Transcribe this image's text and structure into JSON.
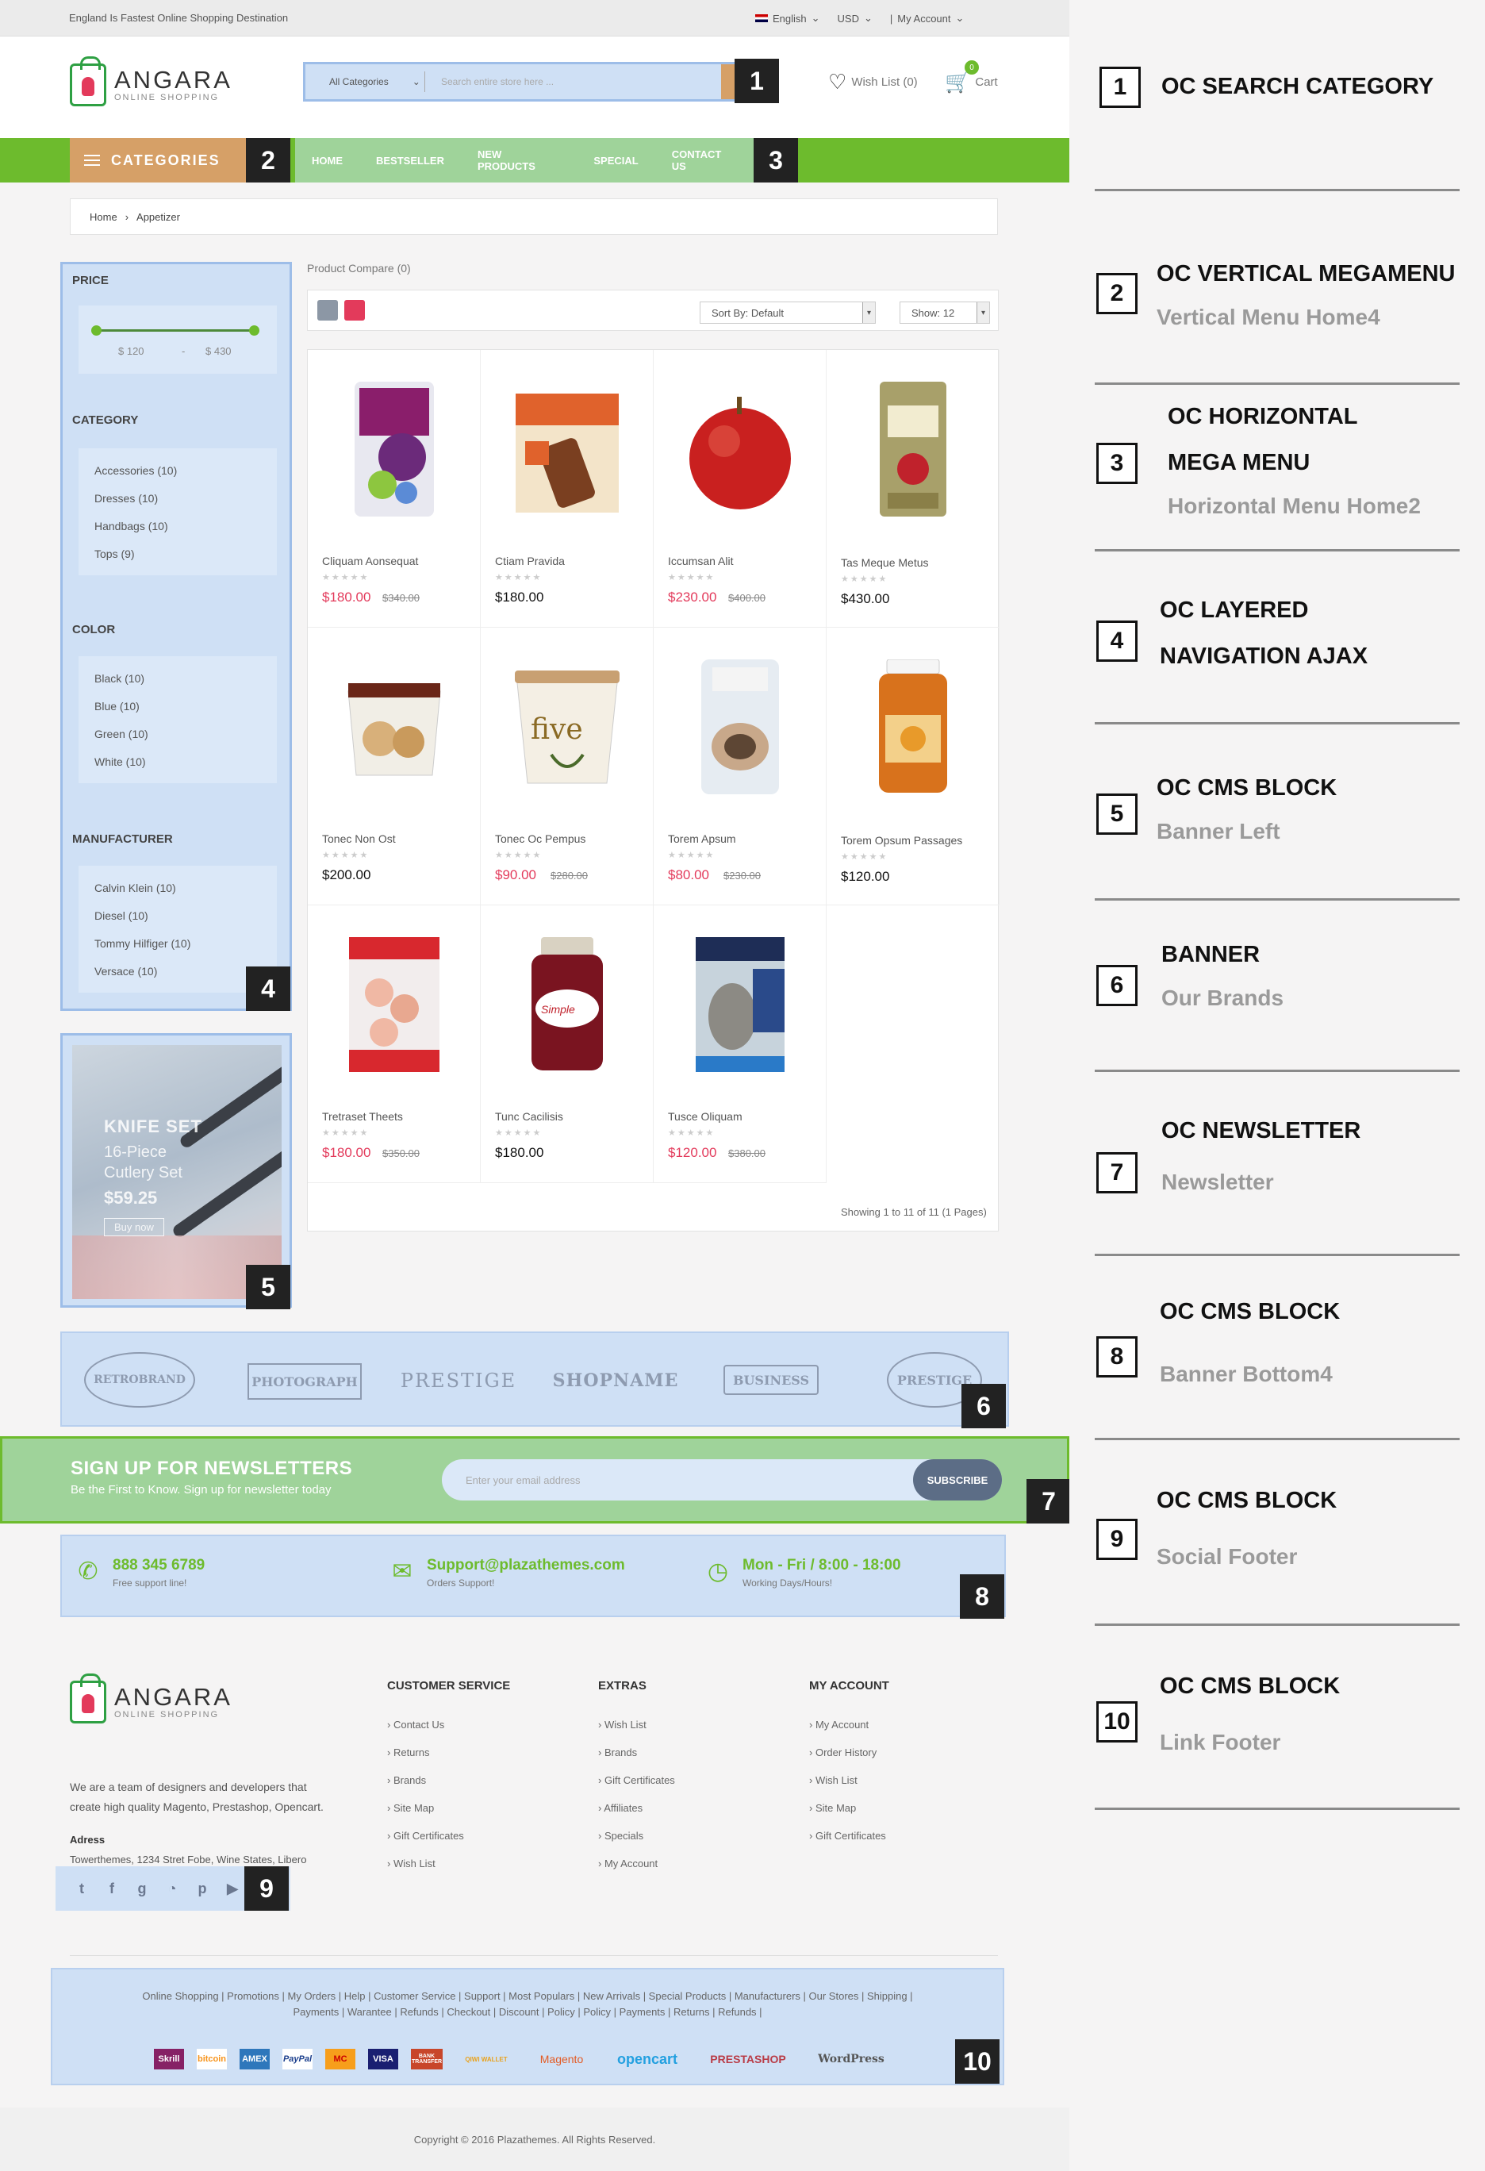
{
  "topbar": {
    "tagline": "England Is Fastest Online Shopping Destination",
    "language": "English",
    "currency": "USD",
    "account": "My Account"
  },
  "header": {
    "logo_name": "ANGARA",
    "logo_sub": "ONLINE SHOPPING",
    "search_category": "All Categories",
    "search_placeholder": "Search entire store here ...",
    "wishlist": "Wish List (0)",
    "cart": "Cart",
    "cart_count": "0"
  },
  "nav": {
    "categories": "CATEGORIES",
    "items": [
      "HOME",
      "BESTSELLER",
      "NEW PRODUCTS",
      "SPECIAL",
      "CONTACT US"
    ]
  },
  "breadcrumb": {
    "home": "Home",
    "sep": "›",
    "current": "Appetizer"
  },
  "sidebar": {
    "price_title": "PRICE",
    "price_min": "$ 120",
    "price_sep": "-",
    "price_max": "$ 430",
    "price_low_fraction": 0.0,
    "price_high_fraction": 1.0,
    "category_title": "CATEGORY",
    "categories": [
      "Accessories (10)",
      "Dresses (10)",
      "Handbags (10)",
      "Tops (9)"
    ],
    "color_title": "COLOR",
    "colors": [
      "Black (10)",
      "Blue (10)",
      "Green (10)",
      "White (10)"
    ],
    "manufacturer_title": "MANUFACTURER",
    "manufacturers": [
      "Calvin Klein (10)",
      "Diesel (10)",
      "Tommy Hilfiger (10)",
      "Versace (10)"
    ]
  },
  "banner_left": {
    "title": "KNIFE SET",
    "line1": "16-Piece",
    "line2": "Cutlery Set",
    "price": "$59.25",
    "button": "Buy now"
  },
  "products": {
    "compare": "Product Compare (0)",
    "sort": "Sort By: Default",
    "show": "Show: 12",
    "showing": "Showing 1 to 11 of 11 (1 Pages)",
    "stars": "★★★★★",
    "items": [
      {
        "name": "Cliquam Aonsequat",
        "price": "$180.00",
        "old": "$340.00",
        "sale": true
      },
      {
        "name": "Ctiam Pravida",
        "price": "$180.00",
        "old": "",
        "sale": false
      },
      {
        "name": "Iccumsan Alit",
        "price": "$230.00",
        "old": "$400.00",
        "sale": true
      },
      {
        "name": "Tas Meque Metus",
        "price": "$430.00",
        "old": "",
        "sale": false
      },
      {
        "name": "Tonec Non Ost",
        "price": "$200.00",
        "old": "",
        "sale": false
      },
      {
        "name": "Tonec Oc Pempus",
        "price": "$90.00",
        "old": "$280.00",
        "sale": true
      },
      {
        "name": "Torem Apsum",
        "price": "$80.00",
        "old": "$230.00",
        "sale": true
      },
      {
        "name": "Torem Opsum Passages",
        "price": "$120.00",
        "old": "",
        "sale": false
      },
      {
        "name": "Tretraset Theets",
        "price": "$180.00",
        "old": "$350.00",
        "sale": true
      },
      {
        "name": "Tunc Cacilisis",
        "price": "$180.00",
        "old": "",
        "sale": false
      },
      {
        "name": "Tusce Oliquam",
        "price": "$120.00",
        "old": "$380.00",
        "sale": true
      }
    ]
  },
  "brands": [
    "RETROBRAND",
    "PHOTOGRAPH",
    "PRESTIGE",
    "SHOPNAME",
    "BUSINESS",
    "PRESTIGE"
  ],
  "newsletter": {
    "title": "SIGN UP FOR NEWSLETTERS",
    "subtitle": "Be the First to Know. Sign up for newsletter today",
    "placeholder": "Enter your email address",
    "button": "SUBSCRIBE"
  },
  "info": [
    {
      "main": "888 345 6789",
      "sub": "Free support line!"
    },
    {
      "main": "Support@plazathemes.com",
      "sub": "Orders Support!"
    },
    {
      "main": "Mon - Fri / 8:00 - 18:00",
      "sub": "Working Days/Hours!"
    }
  ],
  "footer": {
    "about": "We are a team of designers and developers that create high quality Magento, Prestashop, Opencart.",
    "address_label": "Adress",
    "address": "Towerthemes, 1234 Stret Fobe, Wine States, Libero",
    "col1_title": "CUSTOMER SERVICE",
    "col1": [
      "Contact Us",
      "Returns",
      "Brands",
      "Site Map",
      "Gift Certificates",
      "Wish List"
    ],
    "col2_title": "EXTRAS",
    "col2": [
      "Wish List",
      "Brands",
      "Gift Certificates",
      "Affiliates",
      "Specials",
      "My Account"
    ],
    "col3_title": "MY ACCOUNT",
    "col3": [
      "My Account",
      "Order History",
      "Wish List",
      "Site Map",
      "Gift Certificates"
    ],
    "social": [
      "twitter-icon",
      "facebook-icon",
      "google-plus-icon",
      "rss-icon",
      "pinterest-icon",
      "youtube-icon"
    ],
    "links_row1": "Online Shopping | Promotions | My Orders | Help | Customer Service | Support | Most Populars | New Arrivals | Special Products | Manufacturers | Our Stores | Shipping |",
    "links_row2": "Payments | Warantee | Refunds | Checkout | Discount | Policy | Policy | Payments | Returns | Refunds |",
    "payments": [
      "Skrill",
      "bitcoin",
      "AMEX",
      "PayPal",
      "MC",
      "VISA",
      "BANK TRANSFER",
      "QIWI WALLET",
      "Magento",
      "opencart",
      "PRESTASHOP",
      "WordPress"
    ],
    "copyright": "Copyright © 2016 Plazathemes. All Rights Reserved."
  },
  "badges": [
    "1",
    "2",
    "3",
    "4",
    "5",
    "6",
    "7",
    "8",
    "9",
    "10"
  ],
  "panel": [
    {
      "num": "1",
      "title1": "OC SEARCH CATEGORY",
      "title2": "",
      "sub": ""
    },
    {
      "num": "2",
      "title1": "OC VERTICAL MEGAMENU",
      "title2": "",
      "sub": "Vertical Menu Home4"
    },
    {
      "num": "3",
      "title1": "OC HORIZONTAL",
      "title2": "MEGA MENU",
      "sub": "Horizontal Menu Home2"
    },
    {
      "num": "4",
      "title1": "OC LAYERED",
      "title2": "NAVIGATION AJAX",
      "sub": ""
    },
    {
      "num": "5",
      "title1": "OC CMS BLOCK",
      "title2": "",
      "sub": "Banner Left"
    },
    {
      "num": "6",
      "title1": "BANNER",
      "title2": "",
      "sub": "Our Brands"
    },
    {
      "num": "7",
      "title1": "OC NEWSLETTER",
      "title2": "",
      "sub": "Newsletter"
    },
    {
      "num": "8",
      "title1": "OC CMS BLOCK",
      "title2": "",
      "sub": "Banner Bottom4"
    },
    {
      "num": "9",
      "title1": "OC CMS BLOCK",
      "title2": "",
      "sub": "Social Footer"
    },
    {
      "num": "10",
      "title1": "OC CMS BLOCK",
      "title2": "",
      "sub": "Link Footer"
    }
  ]
}
